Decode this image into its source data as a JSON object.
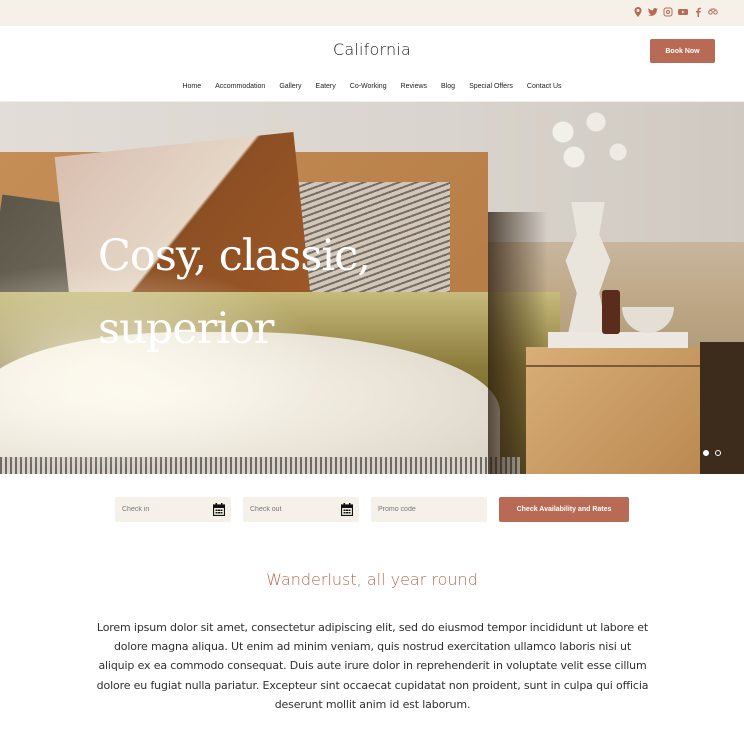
{
  "topbar": {
    "social_icons": [
      "map-pin-icon",
      "twitter-icon",
      "instagram-icon",
      "youtube-icon",
      "facebook-icon",
      "tripadvisor-icon"
    ],
    "icon_color": "#b86a55",
    "background": "#f5f1e8"
  },
  "header": {
    "logo": "California",
    "book_now_label": "Book Now",
    "accent_color": "#b86a55"
  },
  "nav": {
    "items": [
      {
        "label": "Home"
      },
      {
        "label": "Accommodation"
      },
      {
        "label": "Gallery"
      },
      {
        "label": "Eatery"
      },
      {
        "label": "Co-Working"
      },
      {
        "label": "Reviews"
      },
      {
        "label": "Blog"
      },
      {
        "label": "Special Offers"
      },
      {
        "label": "Contact Us"
      }
    ]
  },
  "hero": {
    "title": "Cosy, classic, superior",
    "slides": 2,
    "active_slide": 1
  },
  "booking": {
    "check_in_placeholder": "Check in",
    "check_out_placeholder": "Check out",
    "promo_placeholder": "Promo code",
    "submit_label": "Check Availability and Rates"
  },
  "intro": {
    "title": "Wanderlust, all year round",
    "body": "Lorem ipsum dolor sit amet, consectetur adipiscing elit, sed do eiusmod tempor incididunt ut labore et dolore magna aliqua. Ut enim ad minim veniam, quis nostrud exercitation ullamco laboris nisi ut aliquip ex ea commodo consequat. Duis aute irure dolor in reprehenderit in voluptate velit esse cillum dolore eu fugiat nulla pariatur. Excepteur sint occaecat cupidatat non proident, sunt in culpa qui officia deserunt mollit anim id est laborum."
  }
}
